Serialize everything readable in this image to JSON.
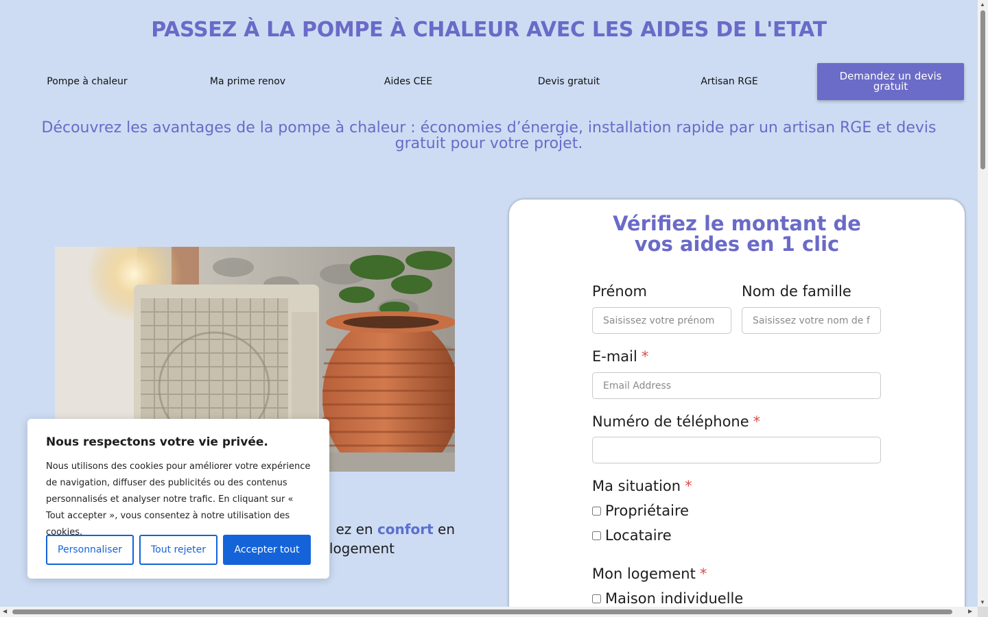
{
  "header": {
    "title": "PASSEZ À LA POMPE À CHALEUR AVEC LES AIDES DE L'ETAT"
  },
  "nav": {
    "items": [
      "Pompe à chaleur",
      "Ma prime renov",
      "Aides CEE",
      "Devis gratuit",
      "Artisan RGE"
    ],
    "cta": "Demandez un devis gratuit"
  },
  "intro": {
    "text": "Découvrez les avantages de la pompe à chaleur : économies d’énergie, installation rapide par un artisan RGE et devis gratuit pour votre projet."
  },
  "hero": {
    "text_before": "ez en ",
    "text_accent": "confort",
    "text_after": " en",
    "text_line2": "logement"
  },
  "form": {
    "title": "Vérifiez le montant de vos aides en 1 clic",
    "first_name_label": "Prénom",
    "first_name_placeholder": "Saisissez votre prénom",
    "last_name_label": "Nom de famille",
    "last_name_placeholder": "Saisissez votre nom de famille",
    "email_label": "E-mail",
    "email_placeholder": "Email Address",
    "phone_label": "Numéro de téléphone",
    "required_mark": "*",
    "situation_label": "Ma situation",
    "situation_options": [
      "Propriétaire",
      "Locataire"
    ],
    "housing_label": "Mon logement",
    "housing_options": [
      "Maison individuelle"
    ]
  },
  "cookie": {
    "title": "Nous respectons votre vie privée.",
    "body": "Nous utilisons des cookies pour améliorer votre expérience de navigation, diffuser des publicités ou des contenus personnalisés et analyser notre trafic. En cliquant sur « Tout accepter », vous consentez à notre utilisation des cookies.",
    "customize": "Personnaliser",
    "reject": "Tout rejeter",
    "accept": "Accepter tout"
  },
  "colors": {
    "background": "#cddcf3",
    "accent": "#6a6ac8",
    "cookie_primary": "#1463d8",
    "required": "#d94e4e"
  }
}
